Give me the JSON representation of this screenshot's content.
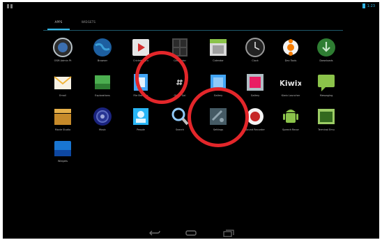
{
  "status": {
    "clock": "1:23"
  },
  "tabs": [
    {
      "label": "APPS"
    },
    {
      "label": "WIDGETS"
    }
  ],
  "apps": [
    {
      "label": "OSM Admin Pt",
      "icon": "globe-pin-icon"
    },
    {
      "label": "Browser",
      "icon": "globe-icon"
    },
    {
      "label": "Cricket Guru",
      "icon": "video-play-icon"
    },
    {
      "label": "Calculator",
      "icon": "calculator-icon"
    },
    {
      "label": "Calendar",
      "icon": "calendar-icon"
    },
    {
      "label": "Clock",
      "icon": "clock-icon"
    },
    {
      "label": "Dev Tools",
      "icon": "gear-flower-icon"
    },
    {
      "label": "Downloads",
      "icon": "download-icon"
    },
    {
      "label": "Email",
      "icon": "email-icon"
    },
    {
      "label": "Explorations",
      "icon": "image-icon"
    },
    {
      "label": "File Browser",
      "icon": "file-browser-icon"
    },
    {
      "label": "Other Gal",
      "icon": "hash-icon"
    },
    {
      "label": "Gallery",
      "icon": "gallery-icon"
    },
    {
      "label": "Gallery",
      "icon": "photo-frame-icon"
    },
    {
      "label": "Kiwix Launcher",
      "icon": "kiwix-icon"
    },
    {
      "label": "Messaging",
      "icon": "messaging-icon"
    },
    {
      "label": "Movie Studio",
      "icon": "clapperboard-icon"
    },
    {
      "label": "Music",
      "icon": "music-speaker-icon"
    },
    {
      "label": "People",
      "icon": "people-icon"
    },
    {
      "label": "Search",
      "icon": "search-icon"
    },
    {
      "label": "Settings",
      "icon": "settings-icon"
    },
    {
      "label": "Sound Recorder",
      "icon": "record-icon"
    },
    {
      "label": "Speech Recor",
      "icon": "android-icon"
    },
    {
      "label": "Terminal Emu",
      "icon": "terminal-icon"
    },
    {
      "label": "Widgets",
      "icon": "widgets-icon"
    }
  ],
  "nav": [
    {
      "icon": "back-icon"
    },
    {
      "icon": "home-icon"
    },
    {
      "icon": "recents-icon"
    }
  ],
  "annotations": {
    "ring_color": "#e3262a"
  }
}
